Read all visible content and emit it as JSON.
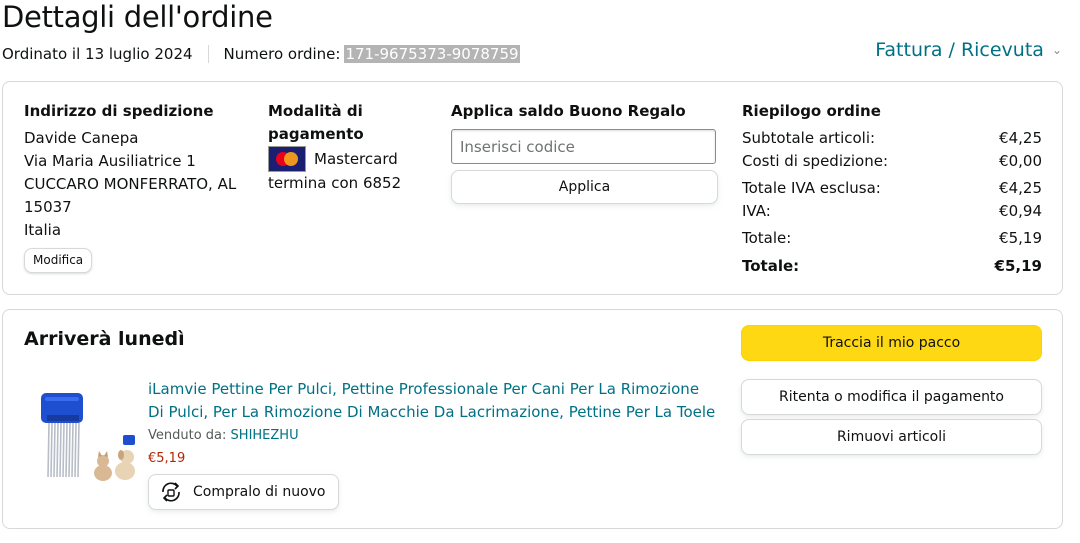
{
  "header": {
    "title": "Dettagli dell'ordine",
    "order_date": "Ordinato il 13 luglio 2024",
    "order_number_label": "Numero ordine:",
    "order_number": "171-9675373-9078759",
    "invoice_link": "Fattura / Ricevuta",
    "invoice_chevron": "⌄"
  },
  "shipping": {
    "heading": "Indirizzo di spedizione",
    "lines": [
      "Davide Canepa",
      "Via Maria Ausiliatrice 1",
      "CUCCARO MONFERRATO, AL",
      "15037",
      "Italia"
    ],
    "edit_button": "Modifica"
  },
  "payment": {
    "heading_line1": "Modalità di",
    "heading_line2": "pagamento",
    "card_icon": "mastercard-logo",
    "card_name": "Mastercard",
    "card_ending": "termina con 6852"
  },
  "gift_card": {
    "heading": "Applica saldo Buono Regalo",
    "placeholder": "Inserisci codice",
    "apply_button": "Applica"
  },
  "summary": {
    "heading": "Riepilogo ordine",
    "rows": [
      {
        "label": "Subtotale articoli:",
        "value": "€4,25"
      },
      {
        "label": "Costi di spedizione:",
        "value": "€0,00"
      },
      {
        "label": "Totale IVA esclusa:",
        "value": "€4,25"
      },
      {
        "label": "IVA:",
        "value": "€0,94"
      },
      {
        "label": "Totale:",
        "value": "€5,19"
      },
      {
        "label": "Totale:",
        "value": "€5,19"
      }
    ]
  },
  "shipment": {
    "arrival": "Arriverà lunedì",
    "product_title": "iLamvie Pettine Per Pulci, Pettine Professionale Per Cani Per La Rimozione Di Pulci, Per La Rimozione Di Macchie Da Lacrimazione, Pettine Per La Toele",
    "sold_by_label": "Venduto da:",
    "seller": "SHIHEZHU",
    "price": "€5,19",
    "buy_again": "Compralo di nuovo",
    "buy_again_icon": "rebuy-icon",
    "product_image_icon": "flea-comb-image"
  },
  "actions": {
    "track": "Traccia il mio pacco",
    "retry_payment": "Ritenta o modifica il pagamento",
    "remove_items": "Rimuovi articoli"
  },
  "colors": {
    "link": "#007185",
    "price": "#b12704",
    "primary_button": "#ffd814",
    "border": "#d5d9d9"
  }
}
